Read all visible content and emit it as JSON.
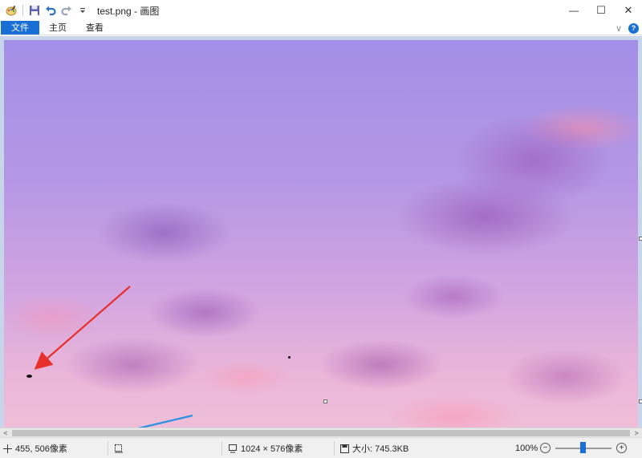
{
  "window": {
    "title": "test.png - 画图",
    "minimize_glyph": "—",
    "maximize_glyph": "☐",
    "close_glyph": "✕"
  },
  "quick_access": {
    "icons": [
      "paint-app-icon",
      "save-icon",
      "undo-icon",
      "redo-icon",
      "customize-dropdown-icon"
    ]
  },
  "ribbon": {
    "tabs": [
      {
        "label": "文件",
        "active": true
      },
      {
        "label": "主页",
        "active": false
      },
      {
        "label": "查看",
        "active": false
      }
    ],
    "collapse_glyph": "∨",
    "help_glyph": "?"
  },
  "status_bar": {
    "cursor_position": "455, 506像素",
    "selection_size": "",
    "image_dimensions": "1024 × 576像素",
    "file_size": "大小: 745.3KB",
    "zoom_level": "100%",
    "zoom_out_glyph": "−",
    "zoom_in_glyph": "+"
  },
  "scrollbar": {
    "left_glyph": "<",
    "right_glyph": ">"
  },
  "annotations": {
    "colors": {
      "red_arrow": "#e8302a",
      "blue_arrow": "#2a92e0"
    }
  },
  "colors": {
    "accent": "#1a6fd6",
    "canvas_background": "#c7d5ea",
    "status_background": "#f0f0f0"
  }
}
